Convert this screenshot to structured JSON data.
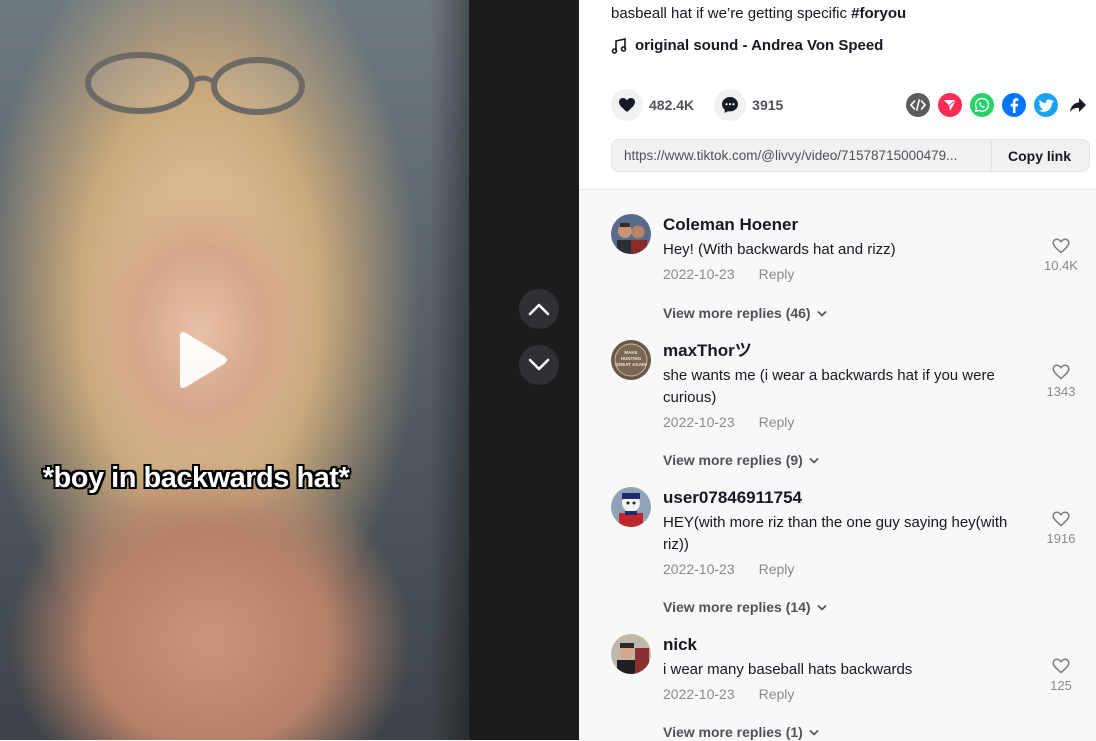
{
  "video": {
    "caption": "*boy in backwards hat*"
  },
  "post": {
    "desc_text": "basbeall hat if we’re getting specific ",
    "desc_tag": "#foryou",
    "music": "original sound - Andrea Von Speed",
    "likes": "482.4K",
    "comments": "3915",
    "link_url": "https://www.tiktok.com/@livvy/video/71578715000479...",
    "copy_label": "Copy link"
  },
  "comments": [
    {
      "user": "Coleman Hoener",
      "text": "Hey! (With backwards hat and rizz)",
      "date": "2022-10-23",
      "reply": "Reply",
      "likes": "10.4K",
      "view_more": "View more replies (46)"
    },
    {
      "user": "maxThorツ",
      "text": "she wants me (i wear a backwards hat if you were curious)",
      "date": "2022-10-23",
      "reply": "Reply",
      "likes": "1343",
      "view_more": "View more replies (9)",
      "avatar_text": "MAKE HUNTING GREAT AGAIN"
    },
    {
      "user": "user07846911754",
      "text": "HEY(with more riz than the one guy saying hey(with riz))",
      "date": "2022-10-23",
      "reply": "Reply",
      "likes": "1916",
      "view_more": "View more replies (14)"
    },
    {
      "user": "nick",
      "text": "i wear many baseball hats backwards",
      "date": "2022-10-23",
      "reply": "Reply",
      "likes": "125",
      "view_more": "View more replies (1)"
    }
  ],
  "colors": {
    "embed": "#5c5c5f",
    "send": "#fe2c55",
    "whatsapp": "#25d366",
    "facebook": "#0075fa",
    "twitter": "#1da1f2"
  }
}
